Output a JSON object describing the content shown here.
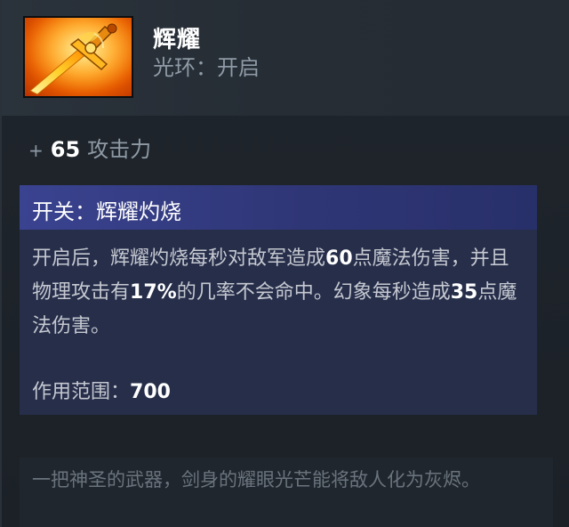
{
  "item": {
    "name": "辉耀",
    "aura_label": "光环：开启"
  },
  "stat": {
    "plus": "+",
    "value": "65",
    "label": "攻击力"
  },
  "ability": {
    "title": "开关：辉耀灼烧",
    "desc_parts": [
      "开启后，辉耀灼烧每秒对敌军造成",
      "60",
      "点魔法伤害，并且物理攻击有",
      "17%",
      "的几率不会命中。幻象每秒造成",
      "35",
      "点魔法伤害。"
    ],
    "range_label": "作用范围：",
    "range_value": "700"
  },
  "lore": {
    "text": "一把神圣的武器，剑身的耀眼光芒能将敌人化为灰烬。"
  },
  "colors": {
    "ability_header": "#3a4390",
    "ability_body": "#262e4a",
    "icon_glow": "#ff9a10"
  }
}
